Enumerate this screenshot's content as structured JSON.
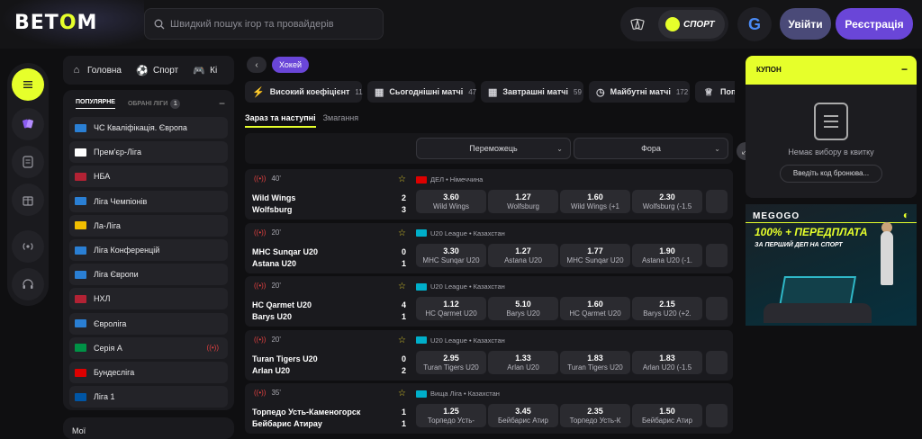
{
  "header": {
    "logo_a": "BET",
    "logo_b": "O",
    "logo_c": "M",
    "search_placeholder": "Швидкий пошук ігор та провайдерів",
    "sport_label": "СПОРТ",
    "google_label": "G",
    "login_label": "Увійти",
    "register_label": "Реєстрація"
  },
  "nav": {
    "items": [
      {
        "label": "Головна",
        "icon": "home-icon"
      },
      {
        "label": "Спорт",
        "icon": "ball-icon"
      },
      {
        "label": "Кі",
        "icon": "gamepad-icon"
      }
    ]
  },
  "leagues": {
    "tab_popular": "ПОПУЛЯРНЕ",
    "tab_favorites": "ОБРАНІ ЛІГИ",
    "favorites_count": "1",
    "items": [
      {
        "name": "ЧС Кваліфікація. Європа",
        "flag": "#2a7fd4"
      },
      {
        "name": "Прем'єр-Ліга",
        "flag": "#ffffff"
      },
      {
        "name": "НБА",
        "flag": "#b22234"
      },
      {
        "name": "Ліга Чемпіонів",
        "flag": "#2a7fd4"
      },
      {
        "name": "Ла-Ліга",
        "flag": "#f1bf00"
      },
      {
        "name": "Ліга Конференцій",
        "flag": "#2a7fd4"
      },
      {
        "name": "Ліга Європи",
        "flag": "#2a7fd4"
      },
      {
        "name": "НХЛ",
        "flag": "#b22234"
      },
      {
        "name": "Євроліга",
        "flag": "#2a7fd4"
      },
      {
        "name": "Серія А",
        "flag": "#009246"
      },
      {
        "name": "Бундесліга",
        "flag": "#dd0000"
      },
      {
        "name": "Ліга 1",
        "flag": "#0055a4"
      }
    ],
    "my_label": "Мої"
  },
  "breadcrumb": {
    "current": "Хокей"
  },
  "filters": [
    {
      "label": "Високий коефіцієнт",
      "count": "11"
    },
    {
      "label": "Сьогоднішні матчі",
      "count": "47"
    },
    {
      "label": "Завтрашні матчі",
      "count": "59"
    },
    {
      "label": "Майбутні матчі",
      "count": "172"
    },
    {
      "label": "Попу",
      "count": ""
    }
  ],
  "subtabs": {
    "active": "Зараз та наступні",
    "inactive": "Змагання"
  },
  "markets": {
    "left": "Переможець",
    "right": "Фора"
  },
  "matches": [
    {
      "time": "40'",
      "league": "ДЕЛ • Німеччина",
      "flag": "#dd0000",
      "team1": "Wild Wings",
      "team2": "Wolfsburg",
      "score1": "2",
      "score2": "3",
      "odds": [
        {
          "v": "3.60",
          "l": "Wild Wings"
        },
        {
          "v": "1.27",
          "l": "Wolfsburg"
        },
        {
          "v": "1.60",
          "l": "Wild Wings (+1"
        },
        {
          "v": "2.30",
          "l": "Wolfsburg (-1.5"
        }
      ]
    },
    {
      "time": "20'",
      "league": "U20 League • Казахстан",
      "flag": "#00afca",
      "team1": "МНС Sunqar U20",
      "team2": "Astana U20",
      "score1": "0",
      "score2": "1",
      "odds": [
        {
          "v": "3.30",
          "l": "МНС Sunqar U20"
        },
        {
          "v": "1.27",
          "l": "Astana U20"
        },
        {
          "v": "1.77",
          "l": "МНС Sunqar U20"
        },
        {
          "v": "1.90",
          "l": "Astana U20 (-1."
        }
      ]
    },
    {
      "time": "20'",
      "league": "U20 League • Казахстан",
      "flag": "#00afca",
      "team1": "HC Qarmet U20",
      "team2": "Barys U20",
      "score1": "4",
      "score2": "1",
      "odds": [
        {
          "v": "1.12",
          "l": "HC Qarmet U20"
        },
        {
          "v": "5.10",
          "l": "Barys U20"
        },
        {
          "v": "1.60",
          "l": "HC Qarmet U20"
        },
        {
          "v": "2.15",
          "l": "Barys U20 (+2."
        }
      ]
    },
    {
      "time": "20'",
      "league": "U20 League • Казахстан",
      "flag": "#00afca",
      "team1": "Turan Tigers U20",
      "team2": "Arlan U20",
      "score1": "0",
      "score2": "2",
      "odds": [
        {
          "v": "2.95",
          "l": "Turan Tigers U20"
        },
        {
          "v": "1.33",
          "l": "Arlan U20"
        },
        {
          "v": "1.83",
          "l": "Turan Tigers U20"
        },
        {
          "v": "1.83",
          "l": "Arlan U20 (-1.5"
        }
      ]
    },
    {
      "time": "35'",
      "league": "Вища Ліга • Казахстан",
      "flag": "#00afca",
      "team1": "Торпедо Усть-Каменогорск",
      "team2": "Бейбарис Атирау",
      "score1": "1",
      "score2": "1",
      "odds": [
        {
          "v": "1.25",
          "l": "Торпедо Усть-"
        },
        {
          "v": "3.45",
          "l": "Бейбарис Атир"
        },
        {
          "v": "2.35",
          "l": "Торпедо Усть-К"
        },
        {
          "v": "1.50",
          "l": "Бейбарис Атир"
        }
      ]
    }
  ],
  "coupon": {
    "title": "КУПОН",
    "empty_text": "Немає вибору в квитку",
    "booking_placeholder": "Введіть код бронюва..."
  },
  "banner": {
    "brand": "MEGOGO",
    "title": "100% + ПЕРЕДПЛАТА",
    "subtitle": "ЗА ПЕРШИЙ ДЕП НА СПОРТ"
  },
  "colors": {
    "accent": "#e6ff2b",
    "primary": "#6a46d8",
    "live": "#e04040"
  }
}
